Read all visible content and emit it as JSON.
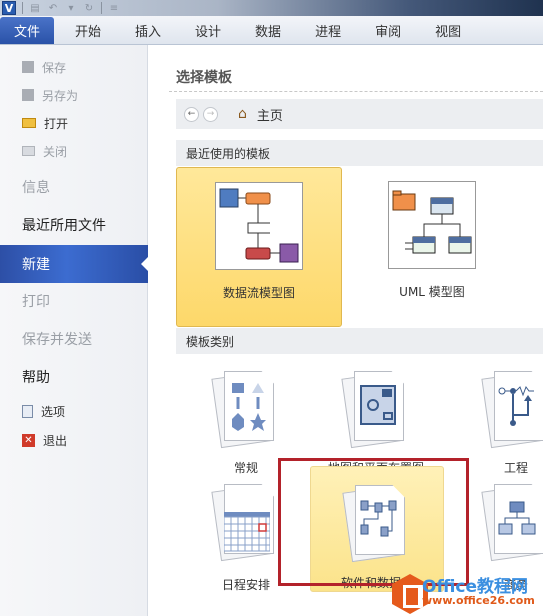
{
  "app": {
    "app_icon": "V",
    "qat": [
      "save-icon",
      "undo-icon",
      "dropdown-icon",
      "redo-icon",
      "customize-icon"
    ]
  },
  "tabs": [
    {
      "label": "文件",
      "active": true
    },
    {
      "label": "开始"
    },
    {
      "label": "插入"
    },
    {
      "label": "设计"
    },
    {
      "label": "数据"
    },
    {
      "label": "进程"
    },
    {
      "label": "审阅"
    },
    {
      "label": "视图"
    }
  ],
  "sidebar": {
    "save": "保存",
    "save_as": "另存为",
    "open": "打开",
    "close": "关闭",
    "info": "信息",
    "recent": "最近所用文件",
    "new": "新建",
    "print": "打印",
    "save_send": "保存并发送",
    "help": "帮助",
    "options": "选项",
    "exit": "退出"
  },
  "main": {
    "title": "选择模板",
    "nav": {
      "back": "←",
      "forward": "→",
      "home_label": "主页"
    },
    "recent_section": "最近使用的模板",
    "recent": [
      {
        "label": "数据流模型图",
        "selected": true
      },
      {
        "label": "UML 模型图",
        "selected": false
      }
    ],
    "category_section": "模板类别",
    "categories": [
      {
        "label": "常规"
      },
      {
        "label": "地图和平面布置图"
      },
      {
        "label": "工程"
      },
      {
        "label": "日程安排"
      },
      {
        "label": "软件和数据库",
        "selected": true,
        "highlighted": true
      },
      {
        "label": "商务"
      }
    ]
  },
  "watermark": {
    "title": "Office教程网",
    "url": "www.office26.com"
  },
  "colors": {
    "accent": "#2d4fa6",
    "selection": "#fdd86a",
    "highlight_box": "#b3222a"
  }
}
